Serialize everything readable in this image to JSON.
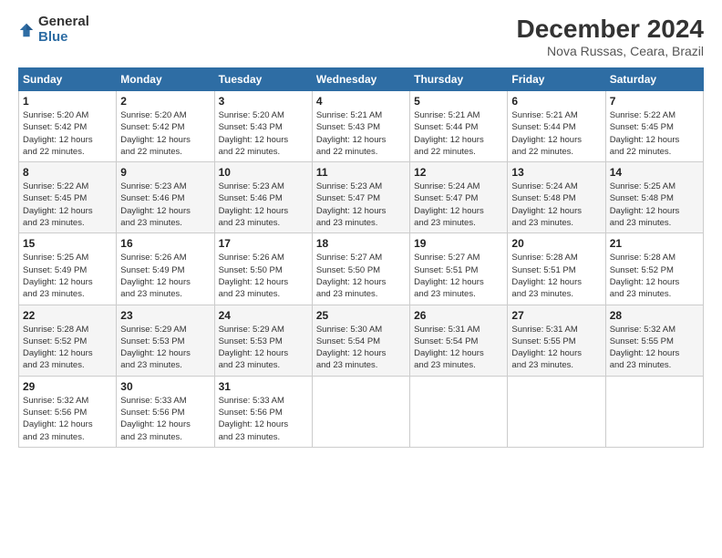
{
  "logo": {
    "general": "General",
    "blue": "Blue"
  },
  "title": "December 2024",
  "subtitle": "Nova Russas, Ceara, Brazil",
  "headers": [
    "Sunday",
    "Monday",
    "Tuesday",
    "Wednesday",
    "Thursday",
    "Friday",
    "Saturday"
  ],
  "weeks": [
    [
      {
        "day": "1",
        "sunrise": "5:20 AM",
        "sunset": "5:42 PM",
        "daylight": "12 hours and 22 minutes."
      },
      {
        "day": "2",
        "sunrise": "5:20 AM",
        "sunset": "5:42 PM",
        "daylight": "12 hours and 22 minutes."
      },
      {
        "day": "3",
        "sunrise": "5:20 AM",
        "sunset": "5:43 PM",
        "daylight": "12 hours and 22 minutes."
      },
      {
        "day": "4",
        "sunrise": "5:21 AM",
        "sunset": "5:43 PM",
        "daylight": "12 hours and 22 minutes."
      },
      {
        "day": "5",
        "sunrise": "5:21 AM",
        "sunset": "5:44 PM",
        "daylight": "12 hours and 22 minutes."
      },
      {
        "day": "6",
        "sunrise": "5:21 AM",
        "sunset": "5:44 PM",
        "daylight": "12 hours and 22 minutes."
      },
      {
        "day": "7",
        "sunrise": "5:22 AM",
        "sunset": "5:45 PM",
        "daylight": "12 hours and 22 minutes."
      }
    ],
    [
      {
        "day": "8",
        "sunrise": "5:22 AM",
        "sunset": "5:45 PM",
        "daylight": "12 hours and 23 minutes."
      },
      {
        "day": "9",
        "sunrise": "5:23 AM",
        "sunset": "5:46 PM",
        "daylight": "12 hours and 23 minutes."
      },
      {
        "day": "10",
        "sunrise": "5:23 AM",
        "sunset": "5:46 PM",
        "daylight": "12 hours and 23 minutes."
      },
      {
        "day": "11",
        "sunrise": "5:23 AM",
        "sunset": "5:47 PM",
        "daylight": "12 hours and 23 minutes."
      },
      {
        "day": "12",
        "sunrise": "5:24 AM",
        "sunset": "5:47 PM",
        "daylight": "12 hours and 23 minutes."
      },
      {
        "day": "13",
        "sunrise": "5:24 AM",
        "sunset": "5:48 PM",
        "daylight": "12 hours and 23 minutes."
      },
      {
        "day": "14",
        "sunrise": "5:25 AM",
        "sunset": "5:48 PM",
        "daylight": "12 hours and 23 minutes."
      }
    ],
    [
      {
        "day": "15",
        "sunrise": "5:25 AM",
        "sunset": "5:49 PM",
        "daylight": "12 hours and 23 minutes."
      },
      {
        "day": "16",
        "sunrise": "5:26 AM",
        "sunset": "5:49 PM",
        "daylight": "12 hours and 23 minutes."
      },
      {
        "day": "17",
        "sunrise": "5:26 AM",
        "sunset": "5:50 PM",
        "daylight": "12 hours and 23 minutes."
      },
      {
        "day": "18",
        "sunrise": "5:27 AM",
        "sunset": "5:50 PM",
        "daylight": "12 hours and 23 minutes."
      },
      {
        "day": "19",
        "sunrise": "5:27 AM",
        "sunset": "5:51 PM",
        "daylight": "12 hours and 23 minutes."
      },
      {
        "day": "20",
        "sunrise": "5:28 AM",
        "sunset": "5:51 PM",
        "daylight": "12 hours and 23 minutes."
      },
      {
        "day": "21",
        "sunrise": "5:28 AM",
        "sunset": "5:52 PM",
        "daylight": "12 hours and 23 minutes."
      }
    ],
    [
      {
        "day": "22",
        "sunrise": "5:28 AM",
        "sunset": "5:52 PM",
        "daylight": "12 hours and 23 minutes."
      },
      {
        "day": "23",
        "sunrise": "5:29 AM",
        "sunset": "5:53 PM",
        "daylight": "12 hours and 23 minutes."
      },
      {
        "day": "24",
        "sunrise": "5:29 AM",
        "sunset": "5:53 PM",
        "daylight": "12 hours and 23 minutes."
      },
      {
        "day": "25",
        "sunrise": "5:30 AM",
        "sunset": "5:54 PM",
        "daylight": "12 hours and 23 minutes."
      },
      {
        "day": "26",
        "sunrise": "5:31 AM",
        "sunset": "5:54 PM",
        "daylight": "12 hours and 23 minutes."
      },
      {
        "day": "27",
        "sunrise": "5:31 AM",
        "sunset": "5:55 PM",
        "daylight": "12 hours and 23 minutes."
      },
      {
        "day": "28",
        "sunrise": "5:32 AM",
        "sunset": "5:55 PM",
        "daylight": "12 hours and 23 minutes."
      }
    ],
    [
      {
        "day": "29",
        "sunrise": "5:32 AM",
        "sunset": "5:56 PM",
        "daylight": "12 hours and 23 minutes."
      },
      {
        "day": "30",
        "sunrise": "5:33 AM",
        "sunset": "5:56 PM",
        "daylight": "12 hours and 23 minutes."
      },
      {
        "day": "31",
        "sunrise": "5:33 AM",
        "sunset": "5:56 PM",
        "daylight": "12 hours and 23 minutes."
      },
      null,
      null,
      null,
      null
    ]
  ],
  "labels": {
    "sunrise": "Sunrise:",
    "sunset": "Sunset:",
    "daylight": "Daylight:"
  }
}
